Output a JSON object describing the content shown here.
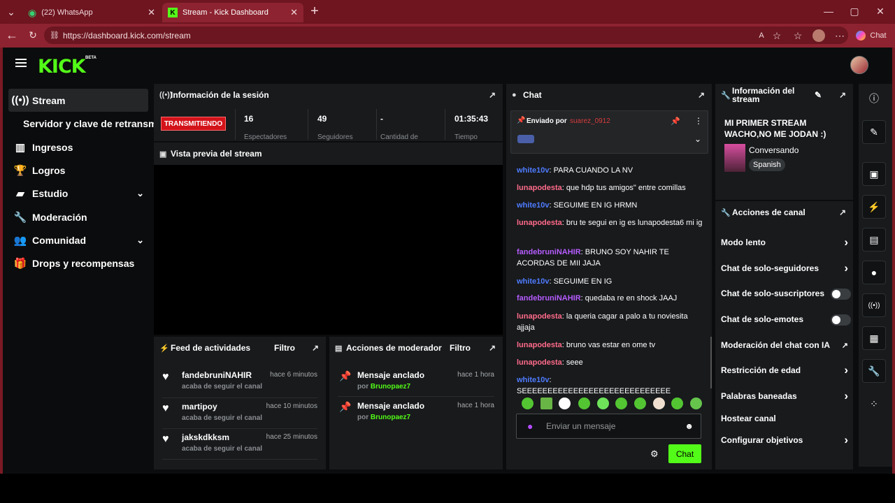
{
  "browser": {
    "tabs": [
      {
        "label": "(22) WhatsApp"
      },
      {
        "label": "Stream - Kick Dashboard"
      }
    ],
    "url": "https://dashboard.kick.com/stream",
    "chat_button": "Chat"
  },
  "app": {
    "logo": "KICK",
    "beta": "BETA"
  },
  "sidebar": {
    "items": [
      {
        "label": "Stream",
        "icon": "broadcast-icon"
      },
      {
        "label": "Servidor y clave de retransm"
      },
      {
        "label": "Ingresos",
        "icon": "chart-icon"
      },
      {
        "label": "Logros",
        "icon": "trophy-icon"
      },
      {
        "label": "Estudio",
        "icon": "studio-icon"
      },
      {
        "label": "Moderación",
        "icon": "wrench-icon"
      },
      {
        "label": "Comunidad",
        "icon": "community-icon"
      },
      {
        "label": "Drops y recompensas",
        "icon": "gift-icon"
      }
    ]
  },
  "session": {
    "title": "Información de la sesión",
    "live_badge": "TRANSMITIENDO",
    "stats": [
      {
        "value": "16",
        "label": "Espectadores"
      },
      {
        "value": "49",
        "label": "Seguidores"
      },
      {
        "value": "-",
        "label": "Cantidad de"
      },
      {
        "value": "01:35:43",
        "label": "Tiempo"
      }
    ]
  },
  "preview": {
    "title": "Vista previa del stream"
  },
  "feed": {
    "title": "Feed de actividades",
    "filter": "Filtro",
    "items": [
      {
        "name": "fandebruniNAHIR",
        "time": "hace 6 minutos",
        "sub": "acaba de seguir el canal"
      },
      {
        "name": "martipoy",
        "time": "hace 10 minutos",
        "sub": "acaba de seguir el canal"
      },
      {
        "name": "jakskdkksm",
        "time": "hace 25 minutos",
        "sub": "acaba de seguir el canal"
      }
    ]
  },
  "mod_actions": {
    "title": "Acciones de moderador",
    "filter": "Filtro",
    "items": [
      {
        "title": "Mensaje anclado",
        "time": "hace 1 hora",
        "by": "por",
        "user": "Brunopaez7"
      },
      {
        "title": "Mensaje anclado",
        "time": "hace 1 hora",
        "by": "por",
        "user": "Brunopaez7"
      }
    ]
  },
  "chat": {
    "title": "Chat",
    "pinned_label": "Enviado por",
    "pinned_user": "suarez_0912",
    "messages": [
      {
        "user": "white10v",
        "text": "PARA CUANDO LA NV",
        "color": "#4f7cff"
      },
      {
        "user": "lunapodesta",
        "text": "que hdp tus amigos\" entre comillas",
        "color": "#ff6b8a"
      },
      {
        "user": "white10v",
        "text": "SEGUIME EN IG HRMN",
        "color": "#4f7cff"
      },
      {
        "user": "lunapodesta",
        "text": "bru te segui en ig es lunapodesta6 mi ig",
        "color": "#ff6b8a"
      },
      {
        "user": "fandebruniNAHIR",
        "text": "BRUNO SOY NAHIR TE ACORDAS DE MII JAJA",
        "color": "#b65cff"
      },
      {
        "user": "white10v",
        "text": "SEGUIME EN IG",
        "color": "#4f7cff"
      },
      {
        "user": "fandebruniNAHIR",
        "text": "quedaba re en shock JAAJ",
        "color": "#b65cff"
      },
      {
        "user": "lunapodesta",
        "text": "la queria cagar a palo a tu noviesita ajjaja",
        "color": "#ff6b8a"
      },
      {
        "user": "lunapodesta",
        "text": "bruno vas estar en ome tv",
        "color": "#ff6b8a"
      },
      {
        "user": "lunapodesta",
        "text": "seee",
        "color": "#ff6b8a"
      },
      {
        "user": "white10v",
        "text": "SEEEEEEEEEEEEEEEEEEEEEEEEEEEEE",
        "color": "#4f7cff"
      }
    ],
    "input_placeholder": "Enviar un mensaje",
    "send_label": "Chat"
  },
  "stream_info": {
    "title": "Información del stream",
    "stream_title": "MI PRIMER STREAM WACHO,NO ME JODAN :)",
    "category": "Conversando",
    "language": "Spanish"
  },
  "channel_actions": {
    "title": "Acciones de canal",
    "items": [
      {
        "label": "Modo lento",
        "control": "arrow"
      },
      {
        "label": "Chat de solo-seguidores",
        "control": "arrow"
      },
      {
        "label": "Chat de solo-suscriptores",
        "control": "toggle"
      },
      {
        "label": "Chat de solo-emotes",
        "control": "toggle"
      },
      {
        "label": "Moderación del chat con IA",
        "control": "external"
      },
      {
        "label": "Restricción de edad",
        "control": "arrow"
      },
      {
        "label": "Palabras baneadas",
        "control": "arrow"
      },
      {
        "label": "Hostear canal",
        "control": "none"
      },
      {
        "label": "Configurar objetivos",
        "control": "arrow"
      }
    ]
  }
}
